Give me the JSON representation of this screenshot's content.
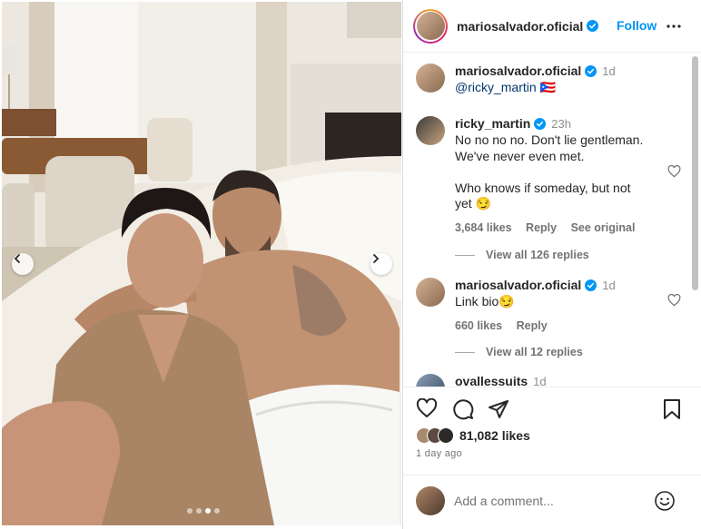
{
  "post": {
    "author": "mariosalvador.oficial",
    "follow_label": "Follow",
    "likes_count": "81,082 likes",
    "posted": "1 day ago",
    "add_comment_placeholder": "Add a comment..."
  },
  "caption": {
    "author": "mariosalvador.oficial",
    "time": "1d",
    "mention": "@ricky_martin",
    "suffix": " 🇵🇷"
  },
  "comments": [
    {
      "author": "ricky_martin",
      "time": "23h",
      "text": "No no no no. Don't lie gentleman.\nWe've never even met.\n\nWho knows if someday, but not\nyet 😏",
      "likes": "3,684 likes",
      "reply": "Reply",
      "see_original": "See original",
      "view_replies": "View all 126 replies"
    },
    {
      "author": "mariosalvador.oficial",
      "time": "1d",
      "text": "Link bio😏",
      "likes": "660 likes",
      "reply": "Reply",
      "view_replies": "View all 12 replies"
    },
    {
      "author": "ovallessuits",
      "time": "1d"
    }
  ],
  "icons": [
    "heart-icon",
    "comment-icon",
    "share-icon",
    "bookmark-icon",
    "more-icon",
    "verified-icon",
    "emoji-icon",
    "chevron-left-icon",
    "chevron-right-icon"
  ],
  "colors": {
    "accent": "#0095f6",
    "verified": "#0095f6",
    "muted": "#737373",
    "mention": "#00376b"
  }
}
